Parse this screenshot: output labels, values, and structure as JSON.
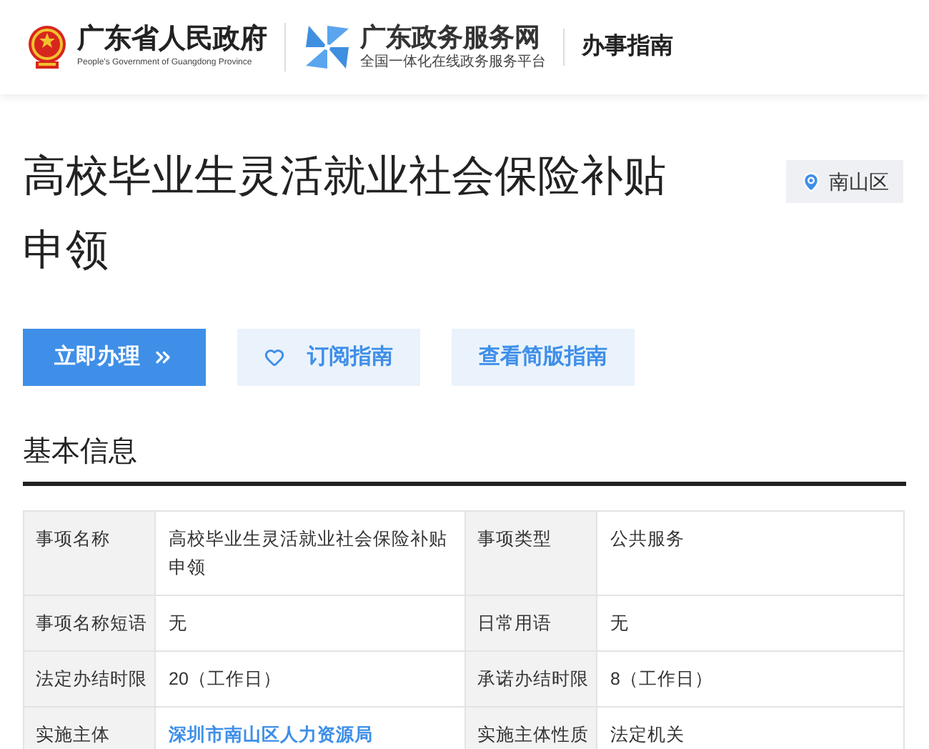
{
  "header": {
    "gov_name": "广东省人民政府",
    "gov_name_en": "People's Government of Guangdong Province",
    "portal_name": "广东政务服务网",
    "portal_slogan": "全国一体化在线政务服务平台",
    "section": "办事指南"
  },
  "title": "高校毕业生灵活就业社会保险补贴申领",
  "location": "南山区",
  "buttons": [
    {
      "label": "立即办理",
      "kind": "primary"
    },
    {
      "label": "订阅指南",
      "kind": "subscribe"
    },
    {
      "label": "查看简版指南",
      "kind": "secondary"
    }
  ],
  "basic_info": {
    "heading": "基本信息",
    "rows": [
      [
        {
          "label": "事项名称",
          "value": "高校毕业生灵活就业社会保险补贴申领",
          "kind": "text"
        },
        {
          "label": "事项类型",
          "value": "公共服务",
          "kind": "text"
        }
      ],
      [
        {
          "label": "事项名称短语",
          "value": "无",
          "kind": "text"
        },
        {
          "label": "日常用语",
          "value": "无",
          "kind": "text"
        }
      ],
      [
        {
          "label": "法定办结时限",
          "value": "20（工作日）",
          "kind": "text"
        },
        {
          "label": "承诺办结时限",
          "value": "8（工作日）",
          "kind": "text"
        }
      ],
      [
        {
          "label": "实施主体",
          "value": "深圳市南山区人力资源局",
          "kind": "link"
        },
        {
          "label": "实施主体性质",
          "value": "法定机关",
          "kind": "text"
        }
      ]
    ]
  }
}
